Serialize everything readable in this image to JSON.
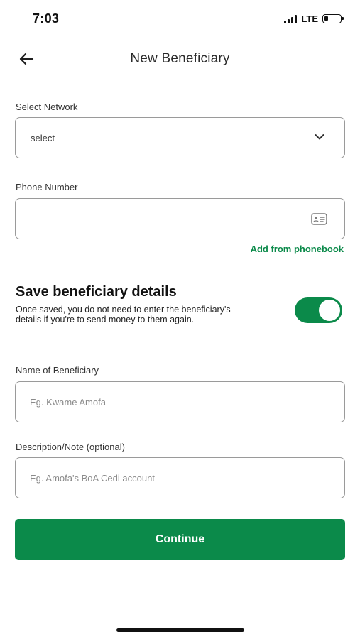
{
  "status_bar": {
    "time": "7:03",
    "network": "LTE",
    "signal_bars": 4,
    "battery_level": 0.25
  },
  "header": {
    "back_icon": "arrow-left-icon",
    "title": "New Beneficiary"
  },
  "network_select": {
    "label": "Select Network",
    "value": "select",
    "icon": "chevron-down-icon"
  },
  "phone": {
    "label": "Phone Number",
    "value": "",
    "icon": "contact-card-icon",
    "phonebook_link": "Add from phonebook"
  },
  "save_details": {
    "title": "Save beneficiary details",
    "description": "Once saved, you do not need to enter the beneficiary's details if you're to send money to them again.",
    "enabled": true
  },
  "beneficiary_name": {
    "label": "Name of Beneficiary",
    "value": "",
    "placeholder": "Eg. Kwame Amofa"
  },
  "description_note": {
    "label": "Description/Note  (optional)",
    "value": "",
    "placeholder": "Eg. Amofa's BoA Cedi account"
  },
  "actions": {
    "continue_label": "Continue"
  },
  "colors": {
    "accent": "#0b8a4a",
    "border": "#9a9a9a",
    "placeholder": "#8a8a8a"
  }
}
